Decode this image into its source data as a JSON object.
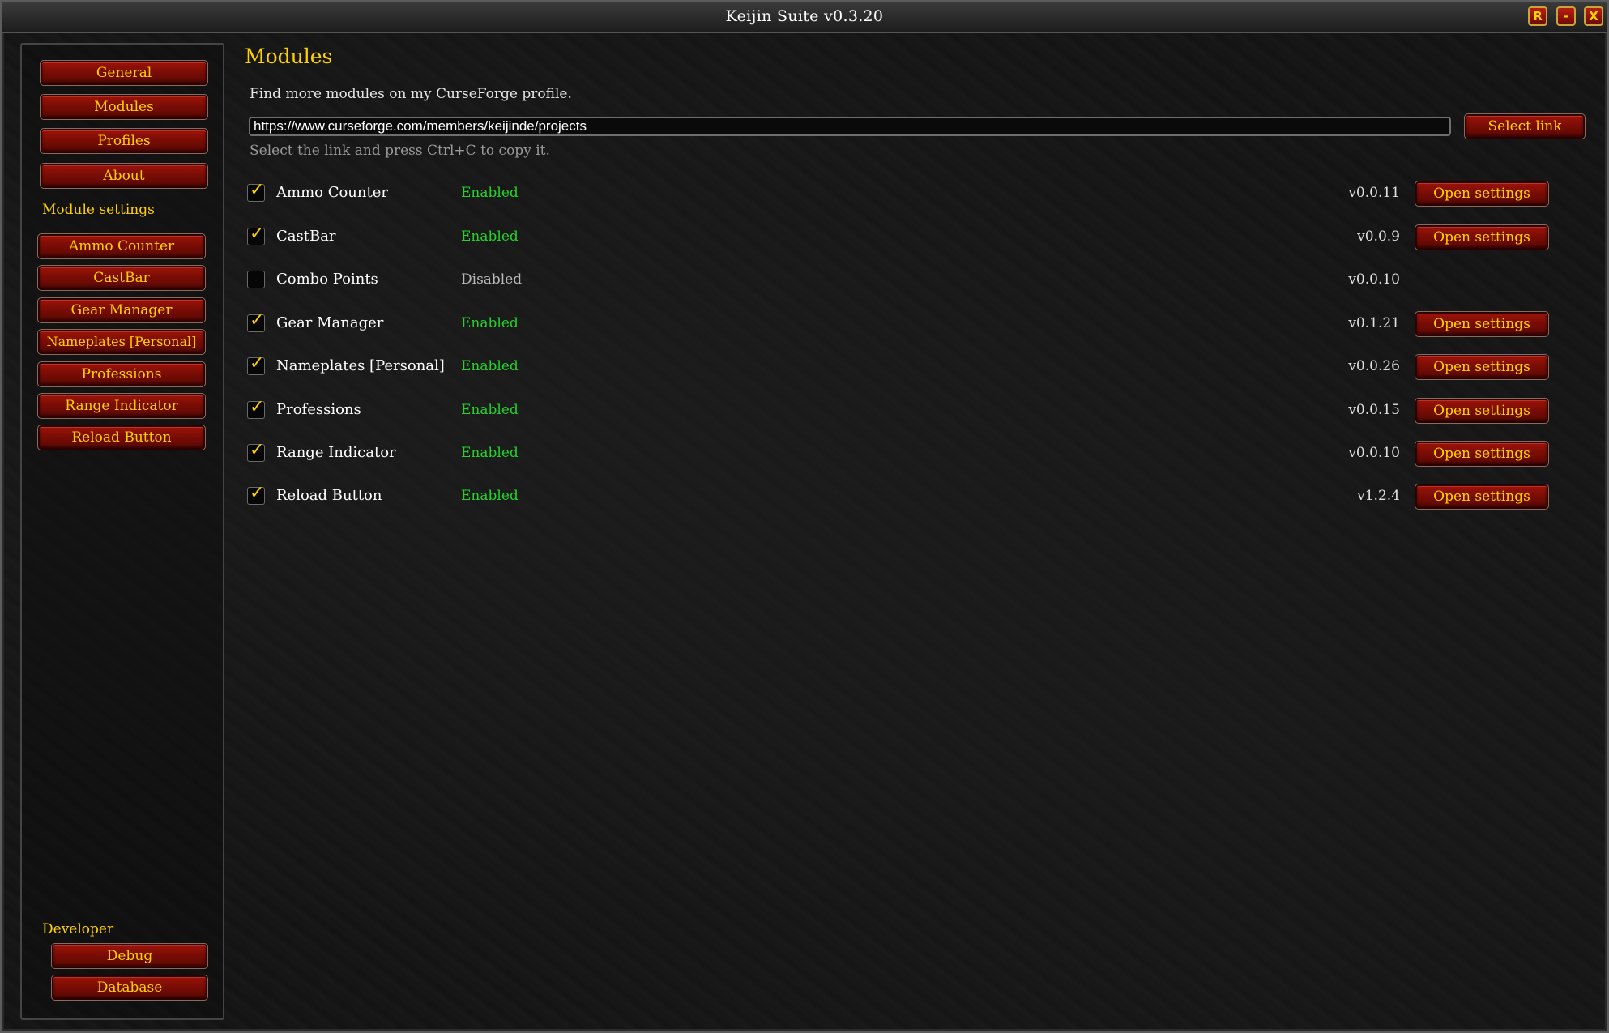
{
  "window": {
    "title": "Keijin Suite v0.3.20",
    "controls": {
      "reload": "R",
      "minimize": "-",
      "close": "X"
    }
  },
  "sidebar": {
    "top_buttons": [
      "General",
      "Modules",
      "Profiles",
      "About"
    ],
    "module_settings_heading": "Module settings",
    "module_buttons": [
      "Ammo Counter",
      "CastBar",
      "Gear Manager",
      "Nameplates [Personal]",
      "Professions",
      "Range Indicator",
      "Reload Button"
    ],
    "developer_heading": "Developer",
    "developer_buttons": [
      "Debug",
      "Database"
    ]
  },
  "main": {
    "title": "Modules",
    "info": "Find more modules on my CurseForge profile.",
    "link_value": "https://www.curseforge.com/members/keijinde/projects",
    "select_link_label": "Select link",
    "hint": "Select the link and press Ctrl+C to copy it.",
    "open_settings_label": "Open settings",
    "modules": [
      {
        "name": "Ammo Counter",
        "status": "Enabled",
        "version": "v0.0.11",
        "enabled": true
      },
      {
        "name": "CastBar",
        "status": "Enabled",
        "version": "v0.0.9",
        "enabled": true
      },
      {
        "name": "Combo Points",
        "status": "Disabled",
        "version": "v0.0.10",
        "enabled": false
      },
      {
        "name": "Gear Manager",
        "status": "Enabled",
        "version": "v0.1.21",
        "enabled": true
      },
      {
        "name": "Nameplates [Personal]",
        "status": "Enabled",
        "version": "v0.0.26",
        "enabled": true
      },
      {
        "name": "Professions",
        "status": "Enabled",
        "version": "v0.0.15",
        "enabled": true
      },
      {
        "name": "Range Indicator",
        "status": "Enabled",
        "version": "v0.0.10",
        "enabled": true
      },
      {
        "name": "Reload Button",
        "status": "Enabled",
        "version": "v1.2.4",
        "enabled": true
      }
    ]
  },
  "colors": {
    "accent_gold": "#ffd100",
    "enabled_green": "#22d32a",
    "button_red": "#8b1007"
  },
  "icons": {
    "checkmark": "checkmark-icon"
  }
}
